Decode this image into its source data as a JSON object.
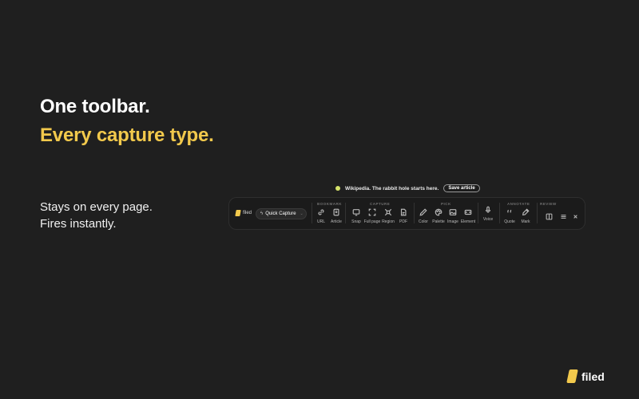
{
  "headline": {
    "line1": "One toolbar.",
    "line2": "Every capture type."
  },
  "subtext": {
    "line1": "Stays on every page.",
    "line2": "Fires instantly."
  },
  "hint": {
    "text": "Wikipedia. The rabbit hole starts here.",
    "button": "Save article"
  },
  "toolbar": {
    "brand": "filed",
    "quick_capture": "Quick Capture",
    "sections": {
      "bookmark": "Bookmark",
      "capture": "Capture",
      "pick": "Pick",
      "annotate": "Annotate",
      "review": "Review"
    },
    "tools": {
      "url": "URL",
      "article": "Article",
      "snap": "Snap",
      "full_page": "Full page",
      "region": "Region",
      "pdf": "PDF",
      "color": "Color",
      "palette": "Palette",
      "image": "Image",
      "element": "Element",
      "voice": "Voice",
      "quote": "Quote",
      "mark": "Mark"
    }
  },
  "logo": {
    "text": "filed"
  },
  "colors": {
    "accent": "#f2c94c",
    "background": "#1f1f1f"
  },
  "icons": [
    "link-icon",
    "document-icon",
    "monitor-icon",
    "expand-icon",
    "region-icon",
    "pdf-icon",
    "pen-icon",
    "palette-icon",
    "image-icon",
    "element-icon",
    "mic-icon",
    "quote-icon",
    "marker-icon",
    "sidebar-icon",
    "menu-icon",
    "close-icon"
  ]
}
